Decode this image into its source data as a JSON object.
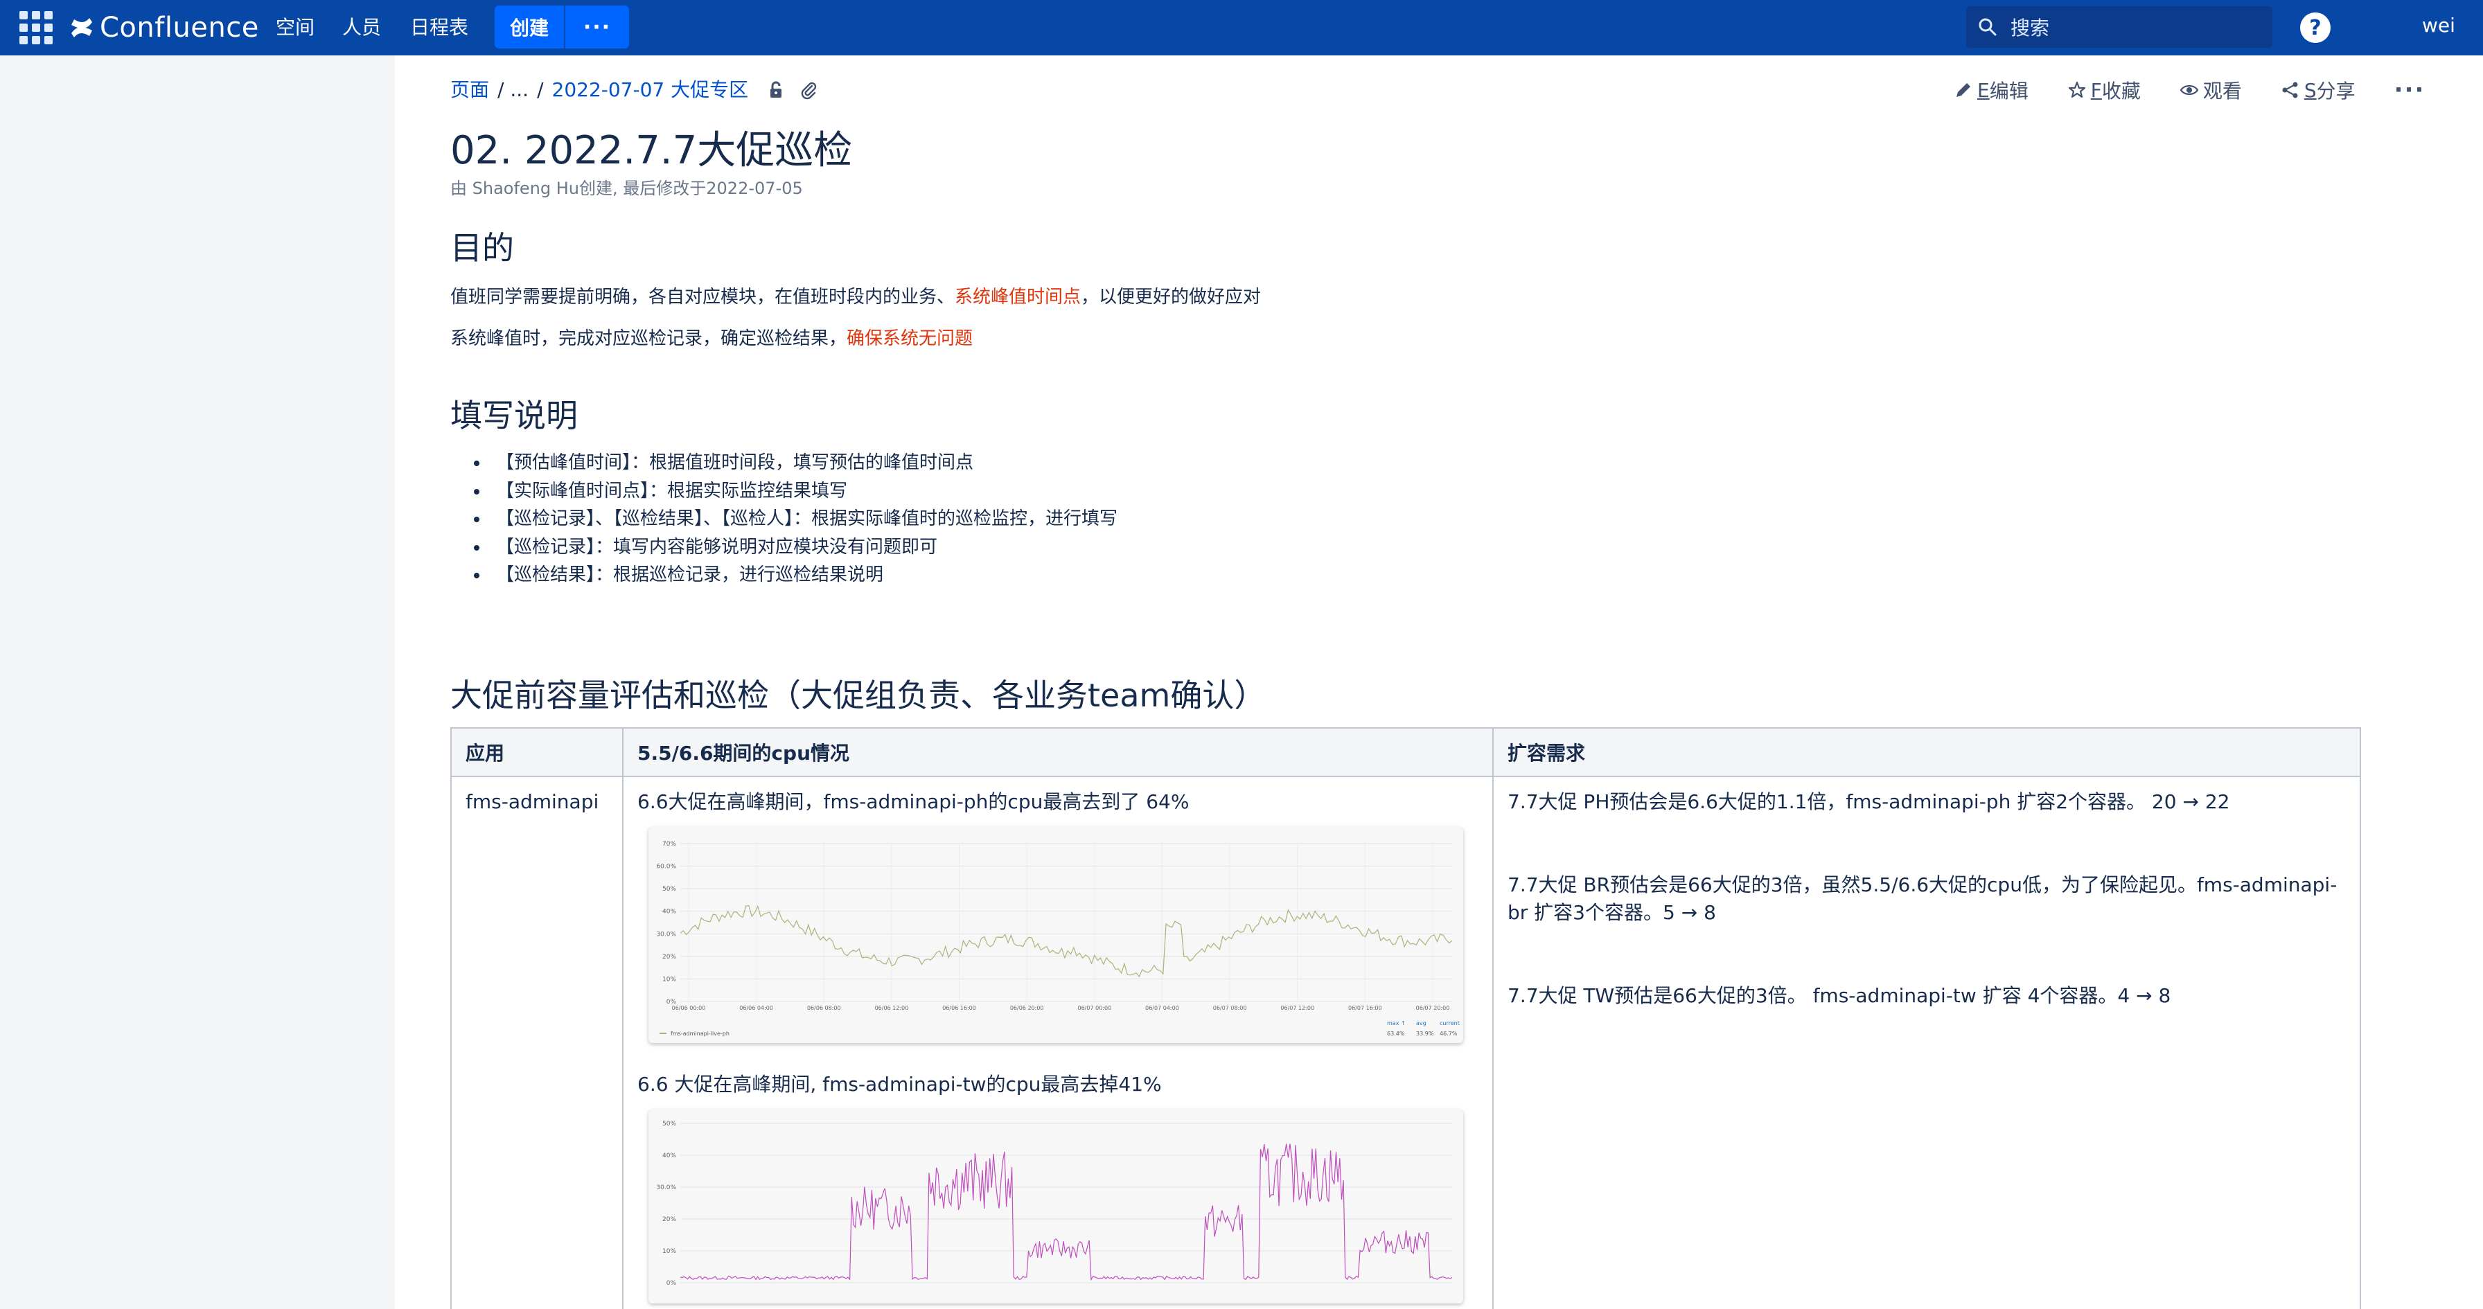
{
  "nav": {
    "logo": "Confluence",
    "items": [
      "空间",
      "人员",
      "日程表"
    ],
    "create": "创建",
    "more": "···",
    "search_placeholder": "搜索",
    "help": "?",
    "user": "wei"
  },
  "breadcrumb": {
    "root": "页面",
    "ellipsis": "/ ...",
    "sep": "/",
    "current": "2022-07-07 大促专区"
  },
  "actions": {
    "edit_key": "E",
    "edit": "编辑",
    "save_key": "F",
    "save": "收藏",
    "watch": "观看",
    "share_key": "S",
    "share": "分享",
    "more": "···"
  },
  "page": {
    "title": "02. 2022.7.7大促巡检",
    "byline": "由 Shaofeng Hu创建, 最后修改于2022-07-05"
  },
  "section_purpose": {
    "heading": "目的",
    "line1_a": "值班同学需要提前明确，各自对应模块，在值班时段内的业务、",
    "line1_red": "系统峰值时间点",
    "line1_b": "，以便更好的做好应对",
    "line2_a": "系统峰值时，完成对应巡检记录，确定巡检结果，",
    "line2_red": "确保系统无问题"
  },
  "section_instructions": {
    "heading": "填写说明",
    "items": [
      "【预估峰值时间】：根据值班时间段，填写预估的峰值时间点",
      "【实际峰值时间点】：根据实际监控结果填写",
      "【巡检记录】、【巡检结果】、【巡检人】：根据实际峰值时的巡检监控，进行填写",
      "【巡检记录】：填写内容能够说明对应模块没有问题即可",
      "【巡检结果】：根据巡检记录，进行巡检结果说明"
    ]
  },
  "section_capacity": {
    "heading": "大促前容量评估和巡检（大促组负责、各业务team确认）"
  },
  "table": {
    "headers": [
      "应用",
      "5.5/6.6期间的cpu情况",
      "扩容需求"
    ],
    "app": "fms-adminapi",
    "cpu_note_1": "6.6大促在高峰期间，fms-adminapi-ph的cpu最高去到了 64%",
    "cpu_note_2": "6.6 大促在高峰期间, fms-adminapi-tw的cpu最高去掉41%",
    "scale_1": "7.7大促 PH预估会是6.6大促的1.1倍，fms-adminapi-ph 扩容2个容器。 20 → 22",
    "scale_2": "7.7大促  BR预估会是66大促的3倍，虽然5.5/6.6大促的cpu低，为了保险起见。fms-adminapi-br 扩容3个容器。5 → 8",
    "scale_3": "7.7大促  TW预估是66大促的3倍。 fms-adminapi-tw 扩容 4个容器。4 → 8"
  },
  "chart1": {
    "y_ticks": [
      "70%",
      "60.0%",
      "50%",
      "40%",
      "30.0%",
      "20%",
      "10%",
      "0%"
    ],
    "x_ticks": [
      "06/06 00:00",
      "06/06 04:00",
      "06/06 08:00",
      "06/06 12:00",
      "06/06 16:00",
      "06/06 20:00",
      "06/07 00:00",
      "06/07 04:00",
      "06/07 08:00",
      "06/07 12:00",
      "06/07 16:00",
      "06/07 20:00"
    ],
    "legend": "fms-adminapi-live-ph",
    "stat_labels": [
      "max ↑",
      "avg",
      "current"
    ],
    "stat_values": [
      "63.4%",
      "33.9%",
      "46.7%"
    ],
    "color": "#a9b47a"
  },
  "chart2": {
    "y_ticks": [
      "50%",
      "40%",
      "30.0%",
      "20%",
      "10%",
      "0%"
    ],
    "color": "#c14dbf"
  }
}
